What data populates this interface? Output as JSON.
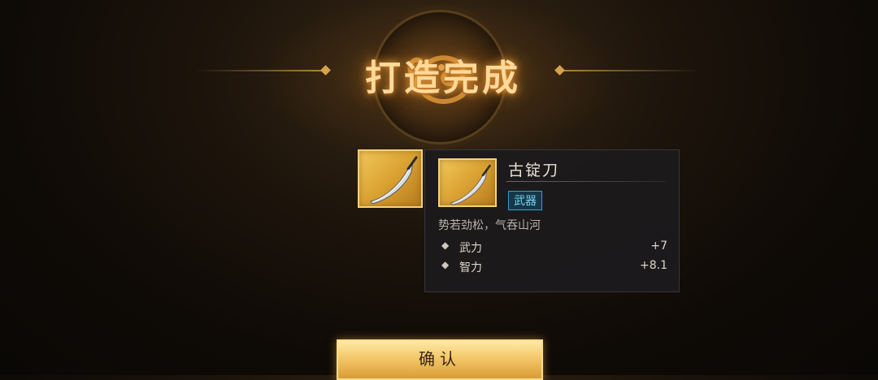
{
  "title": "打造完成",
  "item": {
    "name": "古锭刀",
    "type": "武器",
    "description": "势若劲松，气吞山河",
    "icon": "curved-sword-icon",
    "stats": [
      {
        "label": "武力",
        "value": "+7"
      },
      {
        "label": "智力",
        "value": "+8.1"
      }
    ]
  },
  "confirm_label": "确认",
  "colors": {
    "title_glow": "#ffd99a",
    "slot_gold": "#d9a232",
    "badge_border": "#3aa0c8",
    "tooltip_bg": "#1c1a1c"
  }
}
